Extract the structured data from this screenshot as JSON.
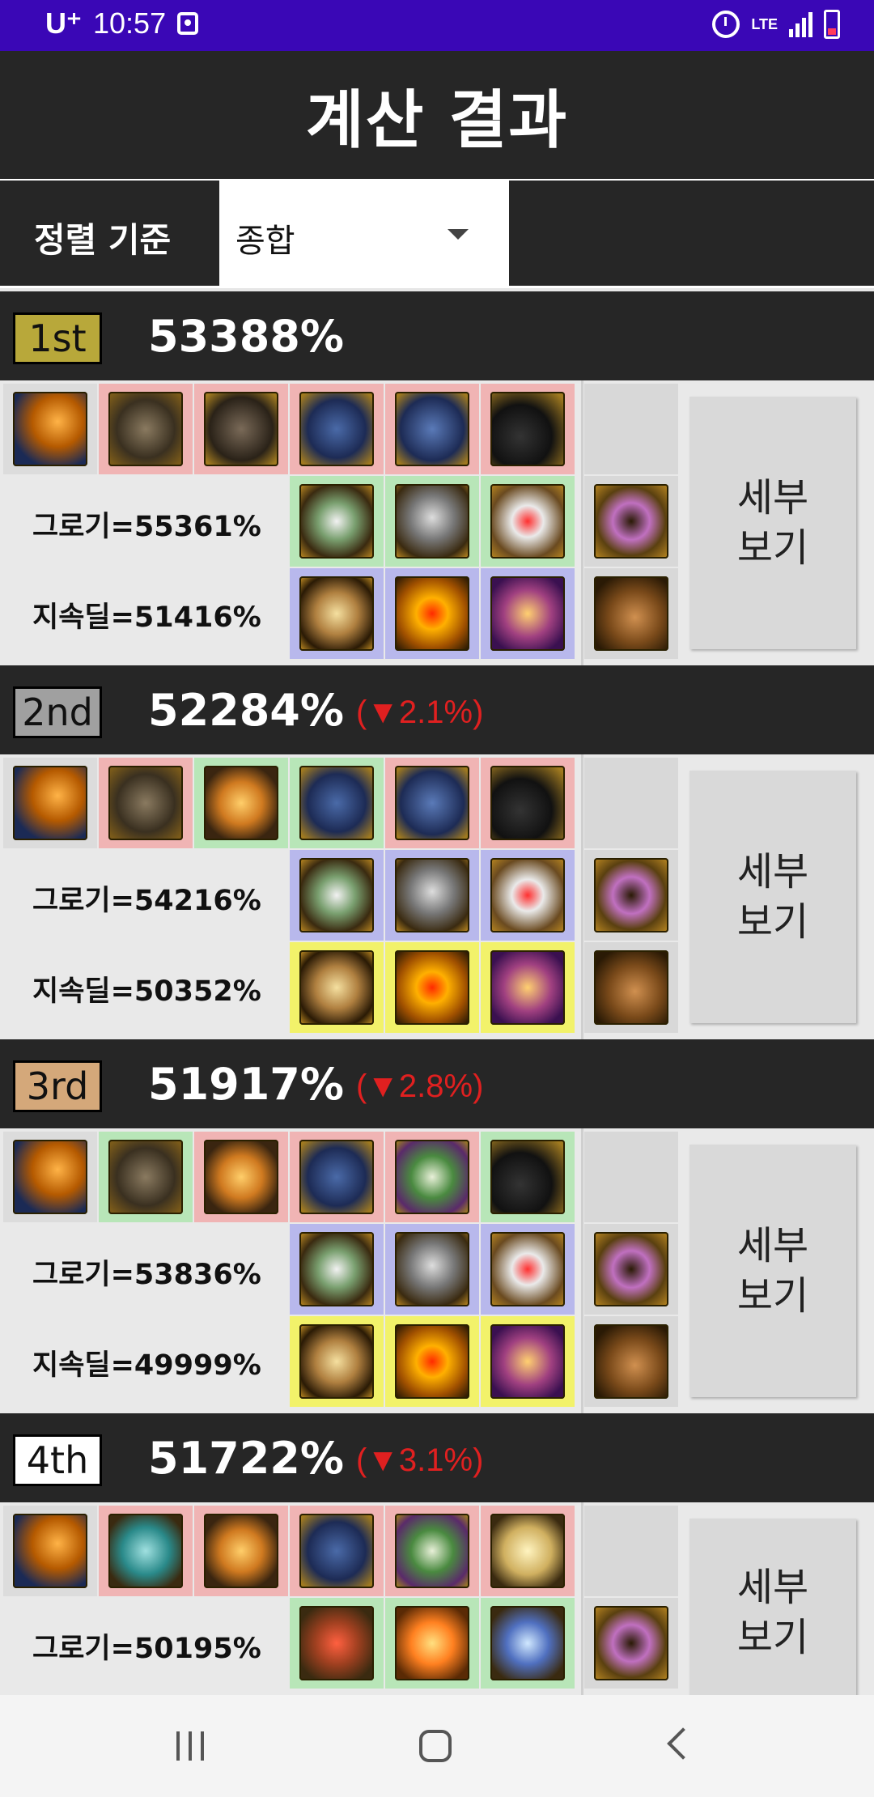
{
  "status_bar": {
    "carrier": "U⁺",
    "time": "10:57",
    "network": "LTE"
  },
  "app_bar": {
    "title": "계산 결과"
  },
  "sort": {
    "label": "정렬 기준",
    "selected": "종합"
  },
  "detail_label": "세부\n보기",
  "results": [
    {
      "rank": "1st",
      "rank_color": "#b8a83a",
      "score": "53388%",
      "delta": "",
      "groggy": "그로기=55361%",
      "sustain": "지속딜=51416%",
      "row1": [
        [
          "w",
          "i-weapon"
        ],
        [
          "p",
          "i-shoulder"
        ],
        [
          "p",
          "i-belt"
        ],
        [
          "p",
          "i-top"
        ],
        [
          "p",
          "i-bottom"
        ],
        [
          "p",
          "i-shoe"
        ],
        [
          "gray",
          "i-empty"
        ]
      ],
      "row2": [
        [
          "g",
          "i-amulet"
        ],
        [
          "g",
          "i-crown"
        ],
        [
          "g",
          "i-ring"
        ],
        [
          "gray",
          "i-band"
        ]
      ],
      "row3": [
        [
          "b",
          "i-pen"
        ],
        [
          "b",
          "i-sun"
        ],
        [
          "b",
          "i-chain"
        ],
        [
          "gray",
          "i-tool"
        ]
      ]
    },
    {
      "rank": "2nd",
      "rank_color": "#a0a0a0",
      "score": "52284%",
      "delta": "(▼2.1%)",
      "groggy": "그로기=54216%",
      "sustain": "지속딜=50352%",
      "row1": [
        [
          "w",
          "i-weapon"
        ],
        [
          "p",
          "i-shoulder"
        ],
        [
          "g",
          "i-orb"
        ],
        [
          "g",
          "i-top"
        ],
        [
          "p",
          "i-bottom"
        ],
        [
          "p",
          "i-shoe"
        ],
        [
          "gray",
          "i-empty"
        ]
      ],
      "row2": [
        [
          "b",
          "i-amulet"
        ],
        [
          "b",
          "i-crown"
        ],
        [
          "b",
          "i-ring"
        ],
        [
          "gray",
          "i-band"
        ]
      ],
      "row3": [
        [
          "y",
          "i-pen"
        ],
        [
          "y",
          "i-sun"
        ],
        [
          "y",
          "i-chain"
        ],
        [
          "gray",
          "i-tool"
        ]
      ]
    },
    {
      "rank": "3rd",
      "rank_color": "#d4a87a",
      "score": "51917%",
      "delta": "(▼2.8%)",
      "groggy": "그로기=53836%",
      "sustain": "지속딜=49999%",
      "row1": [
        [
          "w",
          "i-weapon"
        ],
        [
          "g",
          "i-shoulder"
        ],
        [
          "p",
          "i-orb"
        ],
        [
          "p",
          "i-top"
        ],
        [
          "p",
          "i-green"
        ],
        [
          "g",
          "i-shoe"
        ],
        [
          "gray",
          "i-empty"
        ]
      ],
      "row2": [
        [
          "b",
          "i-amulet"
        ],
        [
          "b",
          "i-crown"
        ],
        [
          "b",
          "i-ring"
        ],
        [
          "gray",
          "i-band"
        ]
      ],
      "row3": [
        [
          "y",
          "i-pen"
        ],
        [
          "y",
          "i-sun"
        ],
        [
          "y",
          "i-chain"
        ],
        [
          "gray",
          "i-tool"
        ]
      ]
    },
    {
      "rank": "4th",
      "rank_color": "#ffffff",
      "score": "51722%",
      "delta": "(▼3.1%)",
      "groggy": "그로기=50195%",
      "sustain": "",
      "row1": [
        [
          "w",
          "i-weapon"
        ],
        [
          "p",
          "i-teal"
        ],
        [
          "p",
          "i-orb"
        ],
        [
          "p",
          "i-top"
        ],
        [
          "p",
          "i-green"
        ],
        [
          "p",
          "i-horn"
        ],
        [
          "gray",
          "i-empty"
        ]
      ],
      "row2": [
        [
          "g",
          "i-crimson"
        ],
        [
          "g",
          "i-fire"
        ],
        [
          "g",
          "i-sapphire"
        ],
        [
          "gray",
          "i-band"
        ]
      ],
      "row3": []
    }
  ]
}
